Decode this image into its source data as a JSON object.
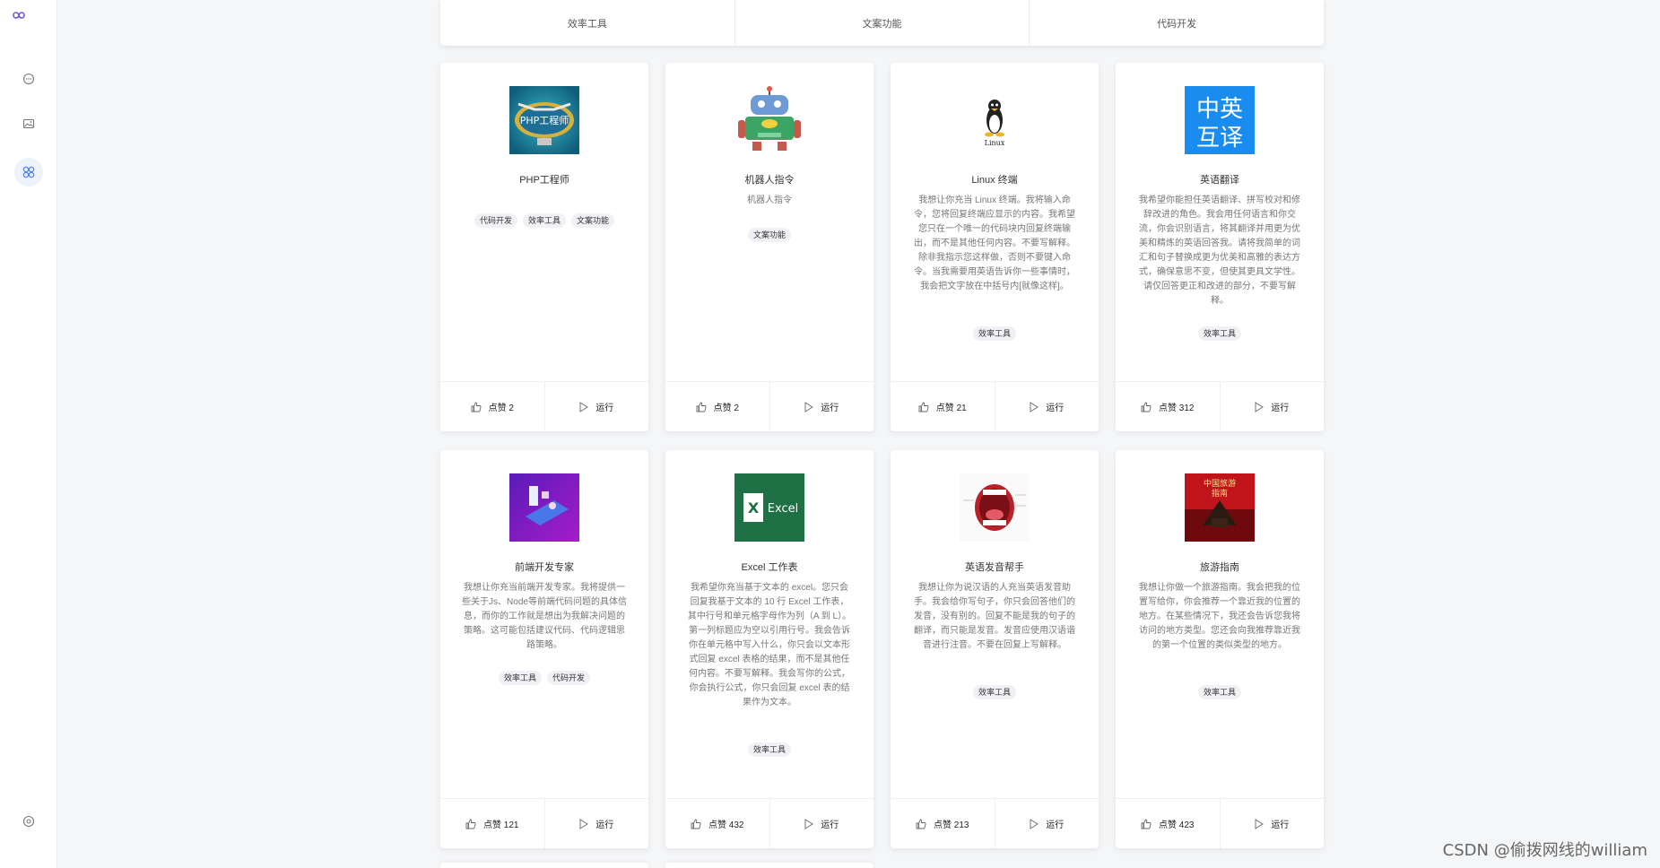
{
  "categories": [
    "效率工具",
    "文案功能",
    "代码开发"
  ],
  "cards": [
    {
      "title": "PHP工程师",
      "desc": "",
      "tags": [
        "代码开发",
        "效率工具",
        "文案功能"
      ],
      "likes": "点赞 2",
      "run": "运行",
      "image_label": "PHP工程师"
    },
    {
      "title": "机器人指令",
      "desc": "机器人指令",
      "tags": [
        "文案功能"
      ],
      "likes": "点赞 2",
      "run": "运行"
    },
    {
      "title": "Linux 终端",
      "desc": "我想让你充当 Linux 终端。我将输入命令，您将回复终端应显示的内容。我希望您只在一个唯一的代码块内回复终端输出，而不是其他任何内容。不要写解释。除非我指示您这样做，否则不要键入命令。当我需要用英语告诉你一些事情时，我会把文字放在中括号内[就像这样]。",
      "tags": [
        "效率工具"
      ],
      "likes": "点赞 21",
      "run": "运行",
      "image_label": "Linux"
    },
    {
      "title": "英语翻译",
      "desc": "我希望你能担任英语翻译、拼写校对和修辞改进的角色。我会用任何语言和你交流，你会识别语言，将其翻译并用更为优美和精炼的英语回答我。请将我简单的词汇和句子替换成更为优美和高雅的表达方式，确保意思不变，但使其更具文学性。请仅回答更正和改进的部分，不要写解释。",
      "tags": [
        "效率工具"
      ],
      "likes": "点赞 312",
      "run": "运行",
      "image_label": "中英互译"
    },
    {
      "title": "前端开发专家",
      "desc": "我想让你充当前端开发专家。我将提供一些关于Js、Node等前端代码问题的具体信息，而你的工作就是想出为我解决问题的策略。这可能包括建议代码、代码逻辑思路策略。",
      "tags": [
        "效率工具",
        "代码开发"
      ],
      "likes": "点赞 121",
      "run": "运行"
    },
    {
      "title": "Excel 工作表",
      "desc": "我希望你充当基于文本的 excel。您只会回复我基于文本的 10 行 Excel 工作表，其中行号和单元格字母作为列（A 到 L）。第一列标题应为空以引用行号。我会告诉你在单元格中写入什么，你只会以文本形式回复 excel 表格的结果，而不是其他任何内容。不要写解释。我会写你的公式，你会执行公式，你只会回复 excel 表的结果作为文本。",
      "tags": [
        "效率工具"
      ],
      "likes": "点赞 432",
      "run": "运行",
      "image_label": "Excel"
    },
    {
      "title": "英语发音帮手",
      "desc": "我想让你为说汉语的人充当英语发音助手。我会给你写句子，你只会回答他们的发音，没有别的。回复不能是我的句子的翻译，而只能是发音。发音应使用汉语谐音进行注音。不要在回复上写解释。",
      "tags": [
        "效率工具"
      ],
      "likes": "点赞 213",
      "run": "运行"
    },
    {
      "title": "旅游指南",
      "desc": "我想让你做一个旅游指南。我会把我的位置写给你，你会推荐一个靠近我的位置的地方。在某些情况下，我还会告诉您我将访问的地方类型。您还会向我推荐靠近我的第一个位置的类似类型的地方。",
      "tags": [
        "效率工具"
      ],
      "likes": "点赞 423",
      "run": "运行",
      "image_label": "中国旅游指南"
    }
  ],
  "watermark": "CSDN @偷拨网线的william",
  "icons": {
    "sidebar": [
      "logo-icon",
      "chat-icon",
      "image-icon",
      "apps-icon",
      "settings-icon"
    ],
    "like": "thumbs-up-icon",
    "run": "play-icon"
  },
  "colors": {
    "accent": "#4f7ef0",
    "logo": "#6a5ae0"
  }
}
